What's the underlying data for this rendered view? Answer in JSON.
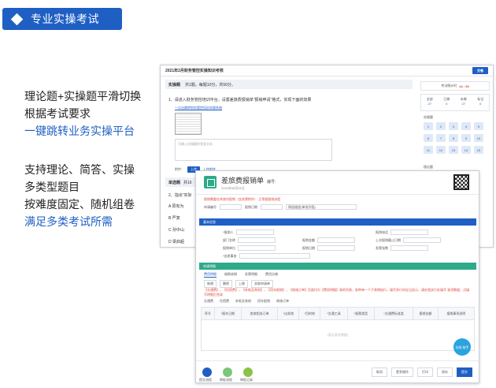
{
  "header": {
    "title": "专业实操考试"
  },
  "copy1": {
    "l1": "理论题+实操题平滑切换",
    "l2": "根据考试要求",
    "l3": "一键跳转业务实操平台"
  },
  "copy2": {
    "l1": "支持理论、简答、实操",
    "l2": "多类型题目",
    "l3": "按难度固定、随机组卷",
    "l4": "满足多类考试所需"
  },
  "exam": {
    "title": "2021年2月财务管控实操知识考核",
    "submit": "交卷",
    "section_label": "实操题",
    "section_info": "共1题，每题10分，共50分。",
    "q1": "1、请进入财务管控培训平台，设置差旅费报销单\"报销申请\"格式，实现下面的效果",
    "link": "一点击跳转财务管控培训实操系统",
    "answer_placeholder": "可输入实操题的答案文本",
    "attach_label": "附件：",
    "upload": "上传",
    "upload_hint": "上传附件",
    "timer_label": "考试倒计时",
    "timer_value": "44 : 53",
    "stats": [
      {
        "label": "全部",
        "n": "27"
      },
      {
        "label": "已做",
        "n": "0"
      },
      {
        "label": "未做",
        "n": "27"
      },
      {
        "label": "标记",
        "n": "0"
      }
    ],
    "sec1": "实操题",
    "sec2": "理论题",
    "grid": [
      "1",
      "2",
      "3",
      "4",
      "5",
      "6",
      "7",
      "8",
      "9",
      "10",
      "11",
      "12",
      "13",
      "14",
      "15"
    ],
    "section2_label": "单选题",
    "section2_info": "共16",
    "q2": "2、指出\"实际",
    "options": [
      "A 原有为",
      "B 严复",
      "C 孙中山",
      "D 梁启超"
    ]
  },
  "form": {
    "title": "差旅费报销单",
    "no": "编号:",
    "subtitle": "2021年08月31日",
    "red_note": "报销需要在系统内报销（含发票附件）     正常报报销流程",
    "row1": [
      "申请编号",
      "报销日期",
      "",
      "原因描述(单选字段)"
    ],
    "sec1": "基本信息",
    "fields_left": [
      "*报销人",
      "部门名称",
      "报销单位",
      "*出差事由"
    ],
    "fields_mid": [
      "*报销部门",
      "报销金额",
      "报销日期"
    ],
    "fields_right": [
      "报销电话",
      "上次报销截止日期",
      "发票张数"
    ],
    "sec2": "申请明细",
    "tabs": [
      "费用明细",
      "借款核销",
      "发票明细",
      "费用分摊"
    ],
    "tools": [
      "新增",
      "删除",
      "上移",
      "关联申请单"
    ],
    "warn": "【交通费】，【住宿费】，【补助及其他】，【用车报销】，【商旅订单】页面均为【费用明细】表的列表，各种单一个子表增加行，填写多行时应当显示，请在相关行处填写 各项数据，点填写明细后完成",
    "subtabs": [
      "交通费",
      "住宿费",
      "补助及其他",
      "用车报销",
      "商旅订单"
    ],
    "cols": [
      "序号",
      "*报车日期",
      "差旅相关订单",
      "*出发地",
      "*目的地",
      "*交通工具",
      "*报票类型",
      "*交通费标准类",
      "报销金额",
      "报销事项说明"
    ],
    "empty": "(暂无相关数据)",
    "help": "在线 助手",
    "footer_icons": [
      "提交流程",
      "审批流程",
      "审批记录"
    ],
    "buttons": [
      "取消",
      "更多操作",
      "打印",
      "保存",
      "提交"
    ]
  }
}
